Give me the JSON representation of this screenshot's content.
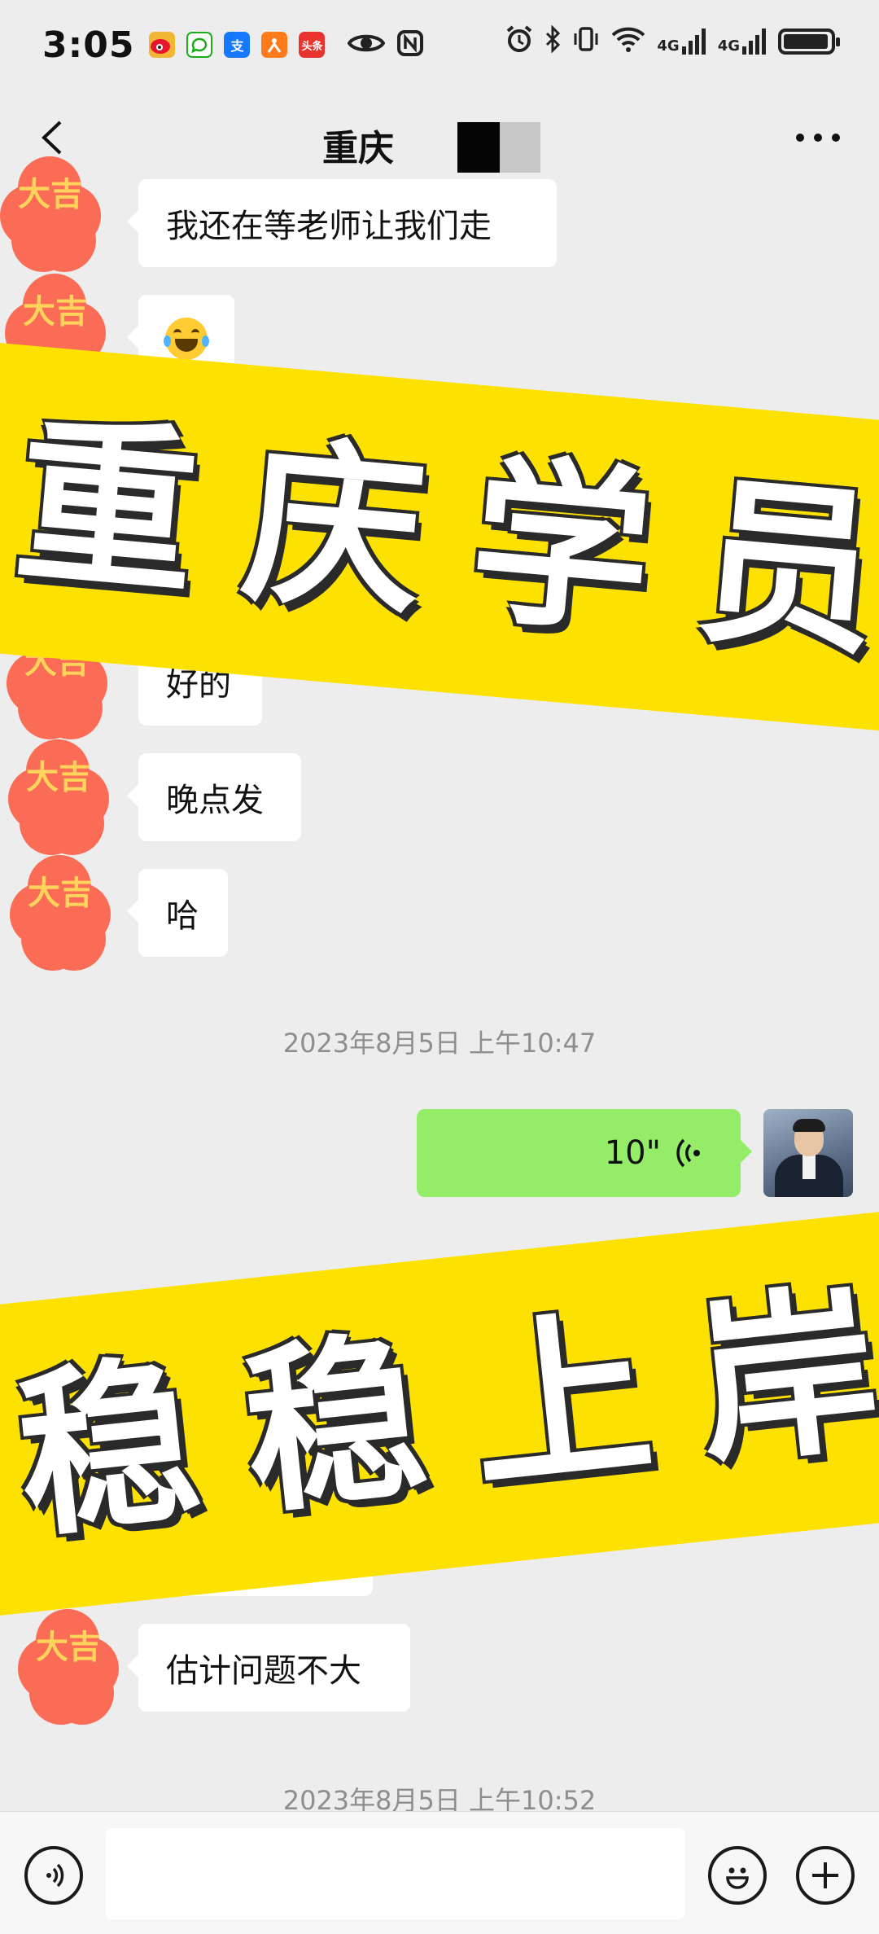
{
  "status_bar": {
    "time": "3:05",
    "network_label_1": "4G",
    "network_label_2": "4G",
    "app_icons": [
      "weibo-icon",
      "message-icon",
      "alipay-icon",
      "app-icon",
      "toutiao-icon",
      "eye-icon",
      "nfc-icon"
    ],
    "system_icons": [
      "alarm-icon",
      "bluetooth-icon",
      "vibrate-icon",
      "wifi-icon",
      "signal-icon",
      "signal-icon",
      "battery-icon"
    ],
    "toutiao_label": "头条",
    "alipay_label": "支"
  },
  "nav": {
    "title": "重庆",
    "back_icon": "chevron-left-icon",
    "more_icon": "more-icon"
  },
  "messages_received_1": [
    {
      "text": "我还在等老师让我们走"
    },
    {
      "text": "",
      "emoji": "laughing-tears-emoji"
    },
    {
      "text": "好的"
    },
    {
      "text": "晚点发"
    },
    {
      "text": "哈"
    }
  ],
  "timestamp_1": "2023年8月5日 上午10:47",
  "sent_voice": {
    "duration": "10\"",
    "icon": "voice-wave-icon"
  },
  "messages_received_2": [
    {
      "text": "估计问题不大"
    }
  ],
  "timestamp_2": "2023年8月5日 上午10:52",
  "stamp_text": "大吉",
  "banner_top": [
    "重",
    "庆",
    "学",
    "员"
  ],
  "banner_bottom": [
    "稳",
    "稳",
    "上",
    "岸"
  ],
  "input_bar": {
    "voice_icon": "voice-input-icon",
    "emoji_icon": "smiley-icon",
    "plus_icon": "plus-icon",
    "placeholder": ""
  },
  "colors": {
    "background": "#ededed",
    "sent_bubble": "#95ec69",
    "banner": "#fde100",
    "stamp": "#fa6c55"
  }
}
